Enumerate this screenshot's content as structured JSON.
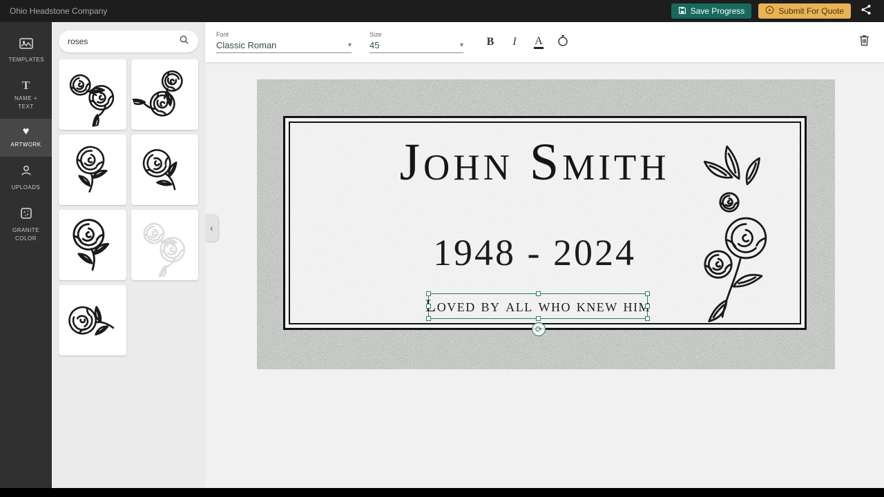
{
  "app": {
    "title": "Ohio Headstone Company"
  },
  "topbar": {
    "save_label": "Save Progress",
    "submit_label": "Submit For Quote"
  },
  "sidebar": {
    "items": [
      {
        "label": "TEMPLATES"
      },
      {
        "label": "NAME + TEXT"
      },
      {
        "label": "ARTWORK",
        "active": true
      },
      {
        "label": "UPLOADS"
      },
      {
        "label": "GRANITE COLOR"
      }
    ]
  },
  "artwork_panel": {
    "search_value": "roses",
    "result_thumbnails": [
      "rose-corner-spray",
      "rose-vine-vertical",
      "rose-single-stem",
      "rose-diagonal-stem",
      "rose-bloom-large",
      "rose-spray-faint",
      "rose-horizontal-stem"
    ]
  },
  "toolbar": {
    "font_label": "Font",
    "font_value": "Classic Roman",
    "size_label": "Size",
    "size_value": "45",
    "bold_glyph": "B",
    "italic_glyph": "I",
    "text_color_glyph": "A"
  },
  "canvas": {
    "name_text": "John Smith",
    "dates_text": "1948 - 2024",
    "epitaph_text": "Loved by all who knew him"
  },
  "icons": {
    "heart_glyph": "♥",
    "text_tool_glyph": "T",
    "collapse_glyph": "‹",
    "caret_glyph": "▾",
    "rotate_glyph": "⟳"
  },
  "colors": {
    "accent_teal": "#17695c",
    "accent_gold": "#e9b355",
    "selection_teal": "#2c7a67"
  }
}
